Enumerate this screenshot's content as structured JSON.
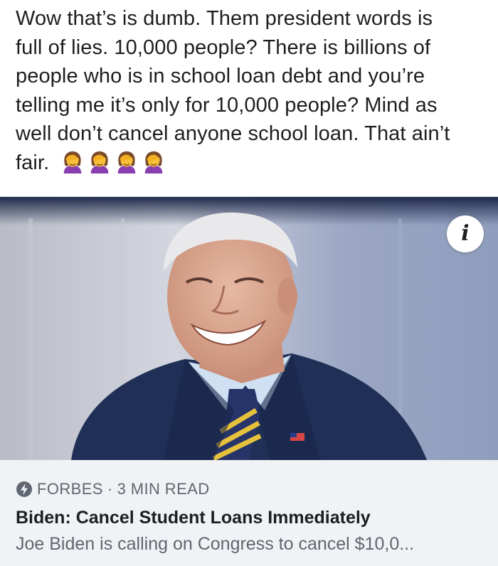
{
  "post": {
    "text_lines": [
      "Wow that’s is dumb. Them president words is",
      "full of lies. 10,000 people? There is billions of",
      "people who is in school loan debt and you’re",
      "telling me it’s only for 10,000 people? Mind as",
      "well don’t cancel anyone school loan. That ain’t",
      "fair."
    ],
    "emoji": [
      "woman-facepalming-icon",
      "woman-facepalming-icon",
      "woman-facepalming-icon",
      "woman-facepalming-icon"
    ]
  },
  "link_card": {
    "image_icon": "person-photo",
    "info_button_glyph": "i",
    "source_icon": "lightning-bolt-icon",
    "source": "FORBES",
    "separator": "·",
    "read_time": "3 MIN READ",
    "headline": "Biden: Cancel Student Loans Immediately",
    "description": "Joe Biden is calling on Congress to cancel $10,0..."
  },
  "colors": {
    "text_primary": "#1c1e21",
    "text_secondary": "#606770",
    "card_background": "#f0f2f5",
    "suit_navy": "#1f2f55",
    "backdrop_blue": "#8f9dbd",
    "emoji_skin": "#f7c23a",
    "emoji_hair": "#7a4a2a",
    "emoji_shirt": "#8a3fb0"
  }
}
